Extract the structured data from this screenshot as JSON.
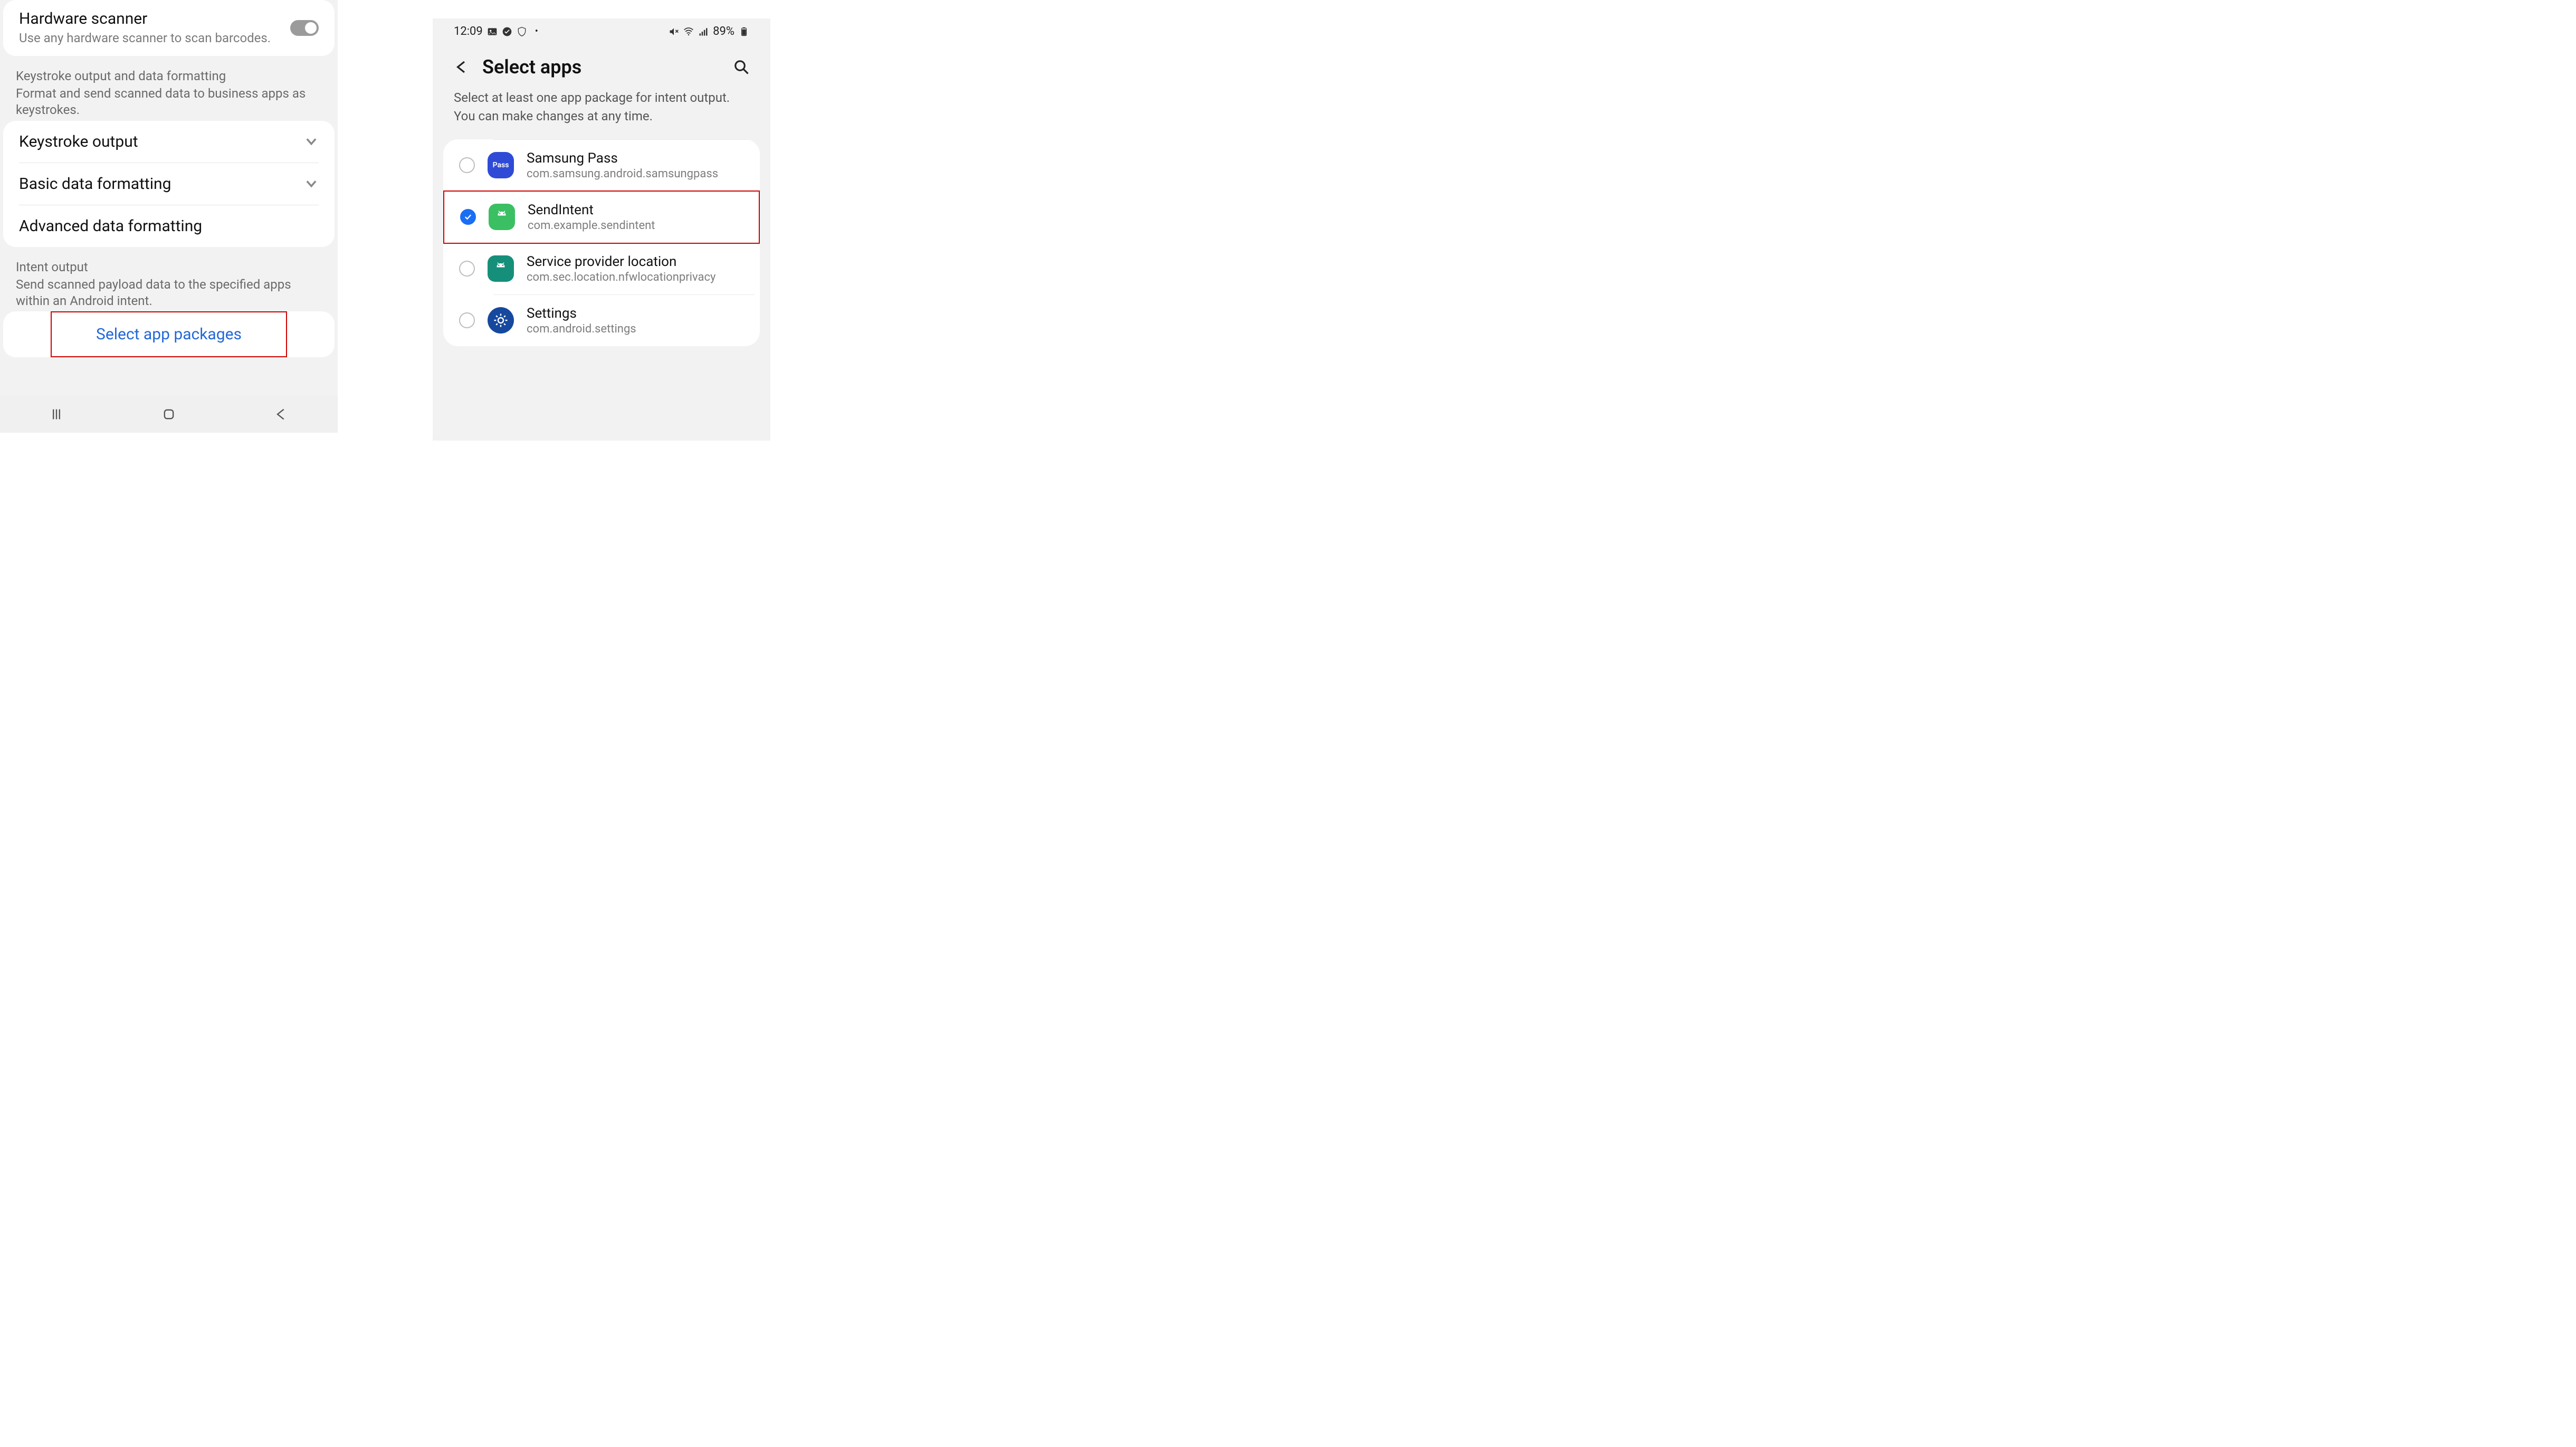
{
  "left": {
    "hardwareScanner": {
      "title": "Hardware scanner",
      "desc": "Use any hardware scanner to scan barcodes."
    },
    "keystrokeSection": {
      "header": "Keystroke output and data formatting",
      "desc": "Format and send scanned data to business apps as keystrokes."
    },
    "rows": {
      "keystrokeOutput": "Keystroke output",
      "basicFormatting": "Basic data formatting",
      "advancedFormatting": "Advanced data formatting"
    },
    "intentSection": {
      "header": "Intent output",
      "desc": "Send scanned payload data to the specified apps within an Android intent."
    },
    "linkLabel": "Select app packages"
  },
  "right": {
    "status": {
      "time": "12:09",
      "battery": "89%"
    },
    "title": "Select apps",
    "instructions": "Select at least one app package for intent output. You can make changes at any time.",
    "apps": [
      {
        "name": "Samsung Pass",
        "pkg": "com.samsung.android.samsungpass",
        "selected": false,
        "iconText": "Pass",
        "iconBg": "#2f4bd6",
        "iconRadius": "16px"
      },
      {
        "name": "SendIntent",
        "pkg": "com.example.sendintent",
        "selected": true,
        "iconText": "",
        "iconBg": "#3bbf63",
        "iconRadius": "14px",
        "android": true,
        "highlight": true
      },
      {
        "name": "Service provider location",
        "pkg": "com.sec.location.nfwlocationprivacy",
        "selected": false,
        "iconText": "",
        "iconBg": "#168f7a",
        "iconRadius": "14px",
        "android": true
      },
      {
        "name": "Settings",
        "pkg": "com.android.settings",
        "selected": false,
        "iconText": "",
        "iconBg": "#16489e",
        "iconRadius": "50%",
        "gear": true
      }
    ]
  }
}
